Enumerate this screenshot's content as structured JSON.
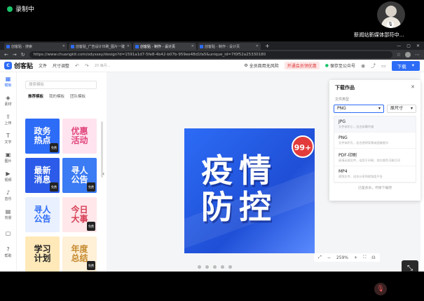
{
  "meeting": {
    "recording_label": "录制中",
    "speaker_name": "新闻站新媒体部符中...",
    "colors": {
      "recording": "#19c46a"
    }
  },
  "browser": {
    "tabs": [
      {
        "label": "创客贴 - 搜索"
      },
      {
        "label": "创客贴_广告设计印刷_图片一键"
      },
      {
        "label": "创客贴 - 制作 - 设计页"
      },
      {
        "label": "创客贴 - 制作 - 设计页"
      }
    ],
    "url": "https://www.chuangkit.com/odyssey/design?d=1591a1d7-5fe8-4b42-b07b-959ee48d1fa5&unique_id=7f0f52a25330180"
  },
  "app": {
    "logo": "创客贴",
    "menu_file": "文件",
    "menu_size": "尺寸调整",
    "toolbar_zoom_hint": "20  每月...",
    "chip_safe": "全员商用无风险",
    "chip_vip": "开通会员领优惠",
    "chip_save": "保存至公众号",
    "download_label": "下载",
    "colors": {
      "accent": "#2d6cf6",
      "poster_badge": "#e23b3b"
    }
  },
  "rail": [
    {
      "icon": "template-icon",
      "glyph": "▦",
      "label": "模板"
    },
    {
      "icon": "material-icon",
      "glyph": "◈",
      "label": "素材"
    },
    {
      "icon": "upload-icon",
      "glyph": "⇪",
      "label": "上传"
    },
    {
      "icon": "text-icon",
      "glyph": "T",
      "label": "文字"
    },
    {
      "icon": "image-icon",
      "glyph": "▣",
      "label": "图片"
    },
    {
      "icon": "video-icon",
      "glyph": "▶",
      "label": "视频"
    },
    {
      "icon": "music-icon",
      "glyph": "♪",
      "label": "音乐"
    },
    {
      "icon": "background-icon",
      "glyph": "▤",
      "label": "背景"
    },
    {
      "icon": "more-icon",
      "glyph": "▢",
      "label": ""
    },
    {
      "icon": "help-icon",
      "glyph": "?",
      "label": "帮助"
    }
  ],
  "panel": {
    "search_placeholder": "搜索模板",
    "tabs": [
      {
        "label": "推荐模板",
        "active": true
      },
      {
        "label": "我的模板",
        "active": false
      },
      {
        "label": "团队模板",
        "active": false
      }
    ],
    "cards": [
      {
        "text": "政务\n热点",
        "bg": "#2d6cf6",
        "fg": "#ffffff",
        "badge": "免费"
      },
      {
        "text": "优惠\n活动",
        "bg": "#ffe3ef",
        "fg": "#e0457b",
        "badge": ""
      },
      {
        "text": "最新\n消息",
        "bg": "#2b5be8",
        "fg": "#ffffff",
        "badge": "免费"
      },
      {
        "text": "寻人\n公告",
        "bg": "#3b7bf3",
        "fg": "#ffffff",
        "badge": "免费"
      },
      {
        "text": "寻人\n公告",
        "bg": "#e9f0ff",
        "fg": "#2d6cf6",
        "badge": ""
      },
      {
        "text": "今日\n大事",
        "bg": "#ffe7ea",
        "fg": "#d63e54",
        "badge": "免费"
      },
      {
        "text": "学习\n计划",
        "bg": "#ffe9b8",
        "fg": "#222222",
        "badge": ""
      },
      {
        "text": "年度\n总结",
        "bg": "#fff0d8",
        "fg": "#c5892c",
        "badge": "免费"
      }
    ]
  },
  "poster": {
    "line1": "疫情",
    "line2": "防控",
    "badge": "99+"
  },
  "canvas_bottom": {
    "zoom": "259%"
  },
  "download_panel": {
    "title": "下载作品",
    "close": "✕",
    "file_type_label": "文件类型",
    "selected_type": "PNG",
    "size_label": "原尺寸",
    "options": [
      {
        "name": "JPG",
        "desc": "文件体积小，适合屏幕传输",
        "hover": true
      },
      {
        "name": "PNG",
        "desc": "文件体积大，适合透明背景或图像细节",
        "hover": false
      },
      {
        "name": "PDF-印刷",
        "desc": "高清无损文件，适用于印刷，地方颜色可能打印",
        "hover": false
      },
      {
        "name": "MP4",
        "desc": "视频文件，适合分享到视频类平台",
        "hover": false
      }
    ],
    "footer": "已是会员，尽情下载吧"
  }
}
